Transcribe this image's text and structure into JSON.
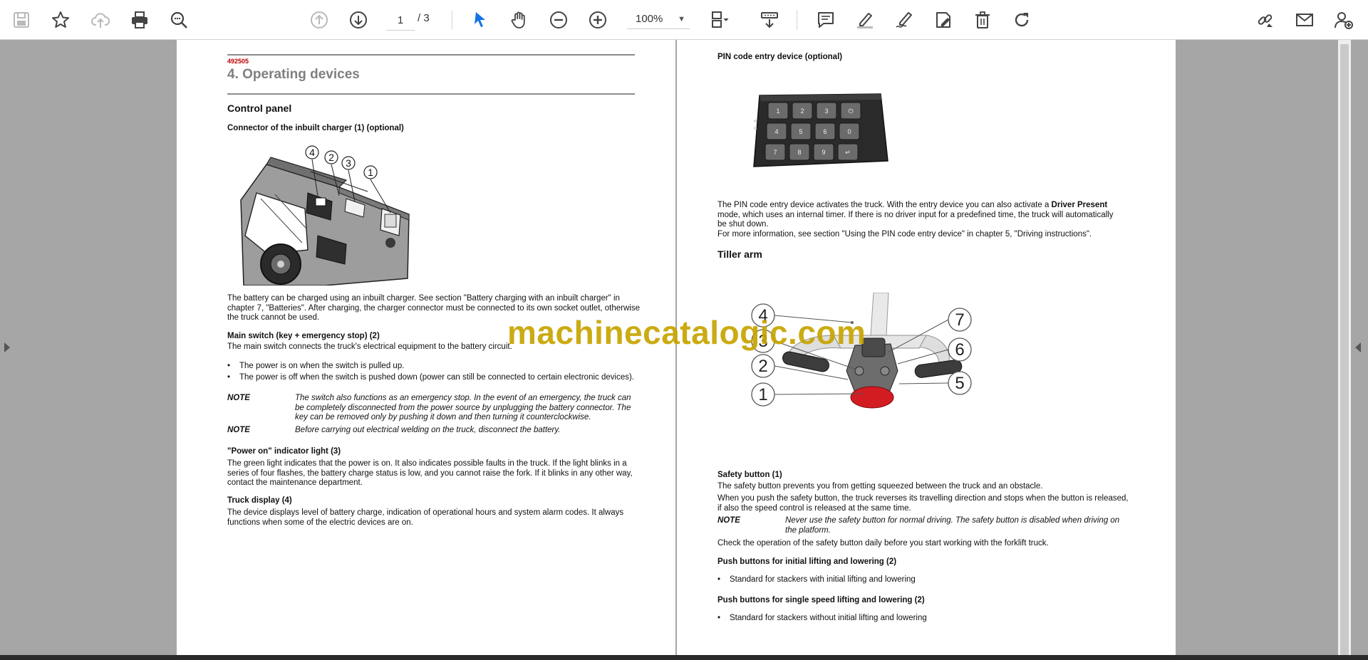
{
  "toolbar": {
    "page_current": "1",
    "page_total": "/ 3",
    "zoom": "100%"
  },
  "watermark": "machinecatalogic.com",
  "page1": {
    "doc_number": "492505",
    "chapter_title": "4. Operating devices",
    "section_title": "Control panel",
    "connector_heading": "Connector of the inbuilt charger (1) (optional)",
    "figure_callouts": [
      "4",
      "2",
      "3",
      "1"
    ],
    "charging_text": [
      "The battery can be charged using an inbuilt charger. See section \"Battery charging with an inbuilt charger\" in",
      "chapter 7, \"Batteries\". After charging, the charger connector must be connected to its own socket outlet, otherwise",
      "the truck cannot be used."
    ],
    "main_switch_heading": "Main switch (key + emergency stop) (2)",
    "main_switch_text": "The main switch connects the truck's electrical equipment to the battery circuit.",
    "bullets": [
      "The power is on when the switch is pulled up.",
      "The power is off when the switch is pushed down (power can still be connected to certain electronic devices)."
    ],
    "note_label": "NOTE",
    "note1": [
      "The switch also functions as an emergency stop. In the event of an emergency, the truck can",
      "be completely disconnected from the power source by unplugging the battery connector. The",
      "key can be removed only by pushing it down and then turning it counterclockwise."
    ],
    "note2": "Before carrying out electrical welding on the truck, disconnect the battery.",
    "power_on_heading": "\"Power on\" indicator light (3)",
    "power_on_text": [
      "The green light indicates that the power is on. It also indicates possible faults in the truck. If the light blinks in a",
      "series of four flashes, the battery charge status is low, and you cannot raise the fork. If it blinks in any other way,",
      "contact the maintenance department."
    ],
    "display_heading": "Truck display (4)",
    "display_text": [
      "The device displays level of battery charge, indication of operational hours and system alarm codes. It always",
      "functions when some of the electric devices are on."
    ]
  },
  "page2": {
    "pin_heading": "PIN code entry device (optional)",
    "keypad_keys": [
      "1",
      "2",
      "3",
      "⏻",
      "4",
      "5",
      "6",
      "0",
      "7",
      "8",
      "9",
      "↵"
    ],
    "pin_text_1a": "The PIN code entry device activates the truck. With the entry device you can also activate a ",
    "pin_text_1b": "Driver Present",
    "pin_text_2": "mode, which uses an internal timer. If there is no driver input for a predefined time, the truck will automatically",
    "pin_text_3": "be shut down.",
    "pin_text_4": "For more information, see section \"Using the PIN code entry device\" in chapter 5, \"Driving instructions\".",
    "tiller_title": "Tiller arm",
    "tiller_callouts": [
      "4",
      "3",
      "2",
      "1",
      "7",
      "6",
      "5"
    ],
    "safety_heading": "Safety button (1)",
    "safety_text_1": "The safety button prevents you from getting squeezed between the truck and an obstacle.",
    "safety_text_2": [
      "When you push the safety button, the truck reverses its travelling direction and stops when the button is released,",
      "if also the speed control is released at the same time."
    ],
    "note_label": "NOTE",
    "safety_note": [
      "Never use the safety button for normal driving. The safety button is disabled when driving on",
      "the platform."
    ],
    "safety_check": "Check the operation of the safety button daily before you start working with the forklift truck.",
    "initial_heading": "Push buttons for initial lifting and lowering (2)",
    "initial_bullet": "Standard for stackers with initial lifting and lowering",
    "single_heading": "Push buttons for single speed lifting and lowering (2)",
    "single_bullet": "Standard for stackers without initial lifting and lowering"
  }
}
